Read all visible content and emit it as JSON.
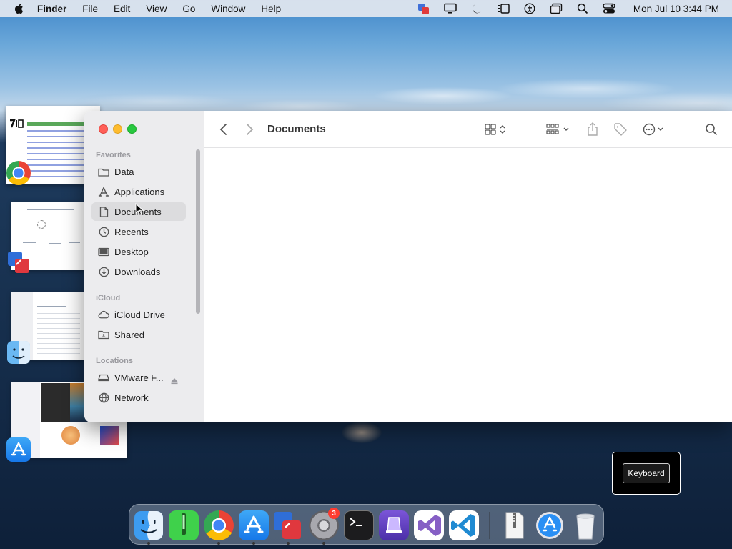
{
  "menubar": {
    "apple": "apple-logo-icon",
    "app_name": "Finder",
    "items": [
      "File",
      "Edit",
      "View",
      "Go",
      "Window",
      "Help"
    ],
    "status_icons": [
      "vmware-icon",
      "display-icon",
      "focus-moon-icon",
      "stage-manager-icon",
      "accessibility-icon",
      "window-icon",
      "spotlight-search-icon",
      "control-center-icon"
    ],
    "clock": "Mon Jul 10  3:44 PM"
  },
  "finder": {
    "title": "Documents",
    "sections": {
      "favorites": "Favorites",
      "icloud": "iCloud",
      "locations": "Locations"
    },
    "favorites": [
      "Data",
      "Applications",
      "Documents",
      "Recents",
      "Desktop",
      "Downloads"
    ],
    "icloud_items": [
      "iCloud Drive",
      "Shared"
    ],
    "location_items": [
      "VMware F...",
      "Network"
    ],
    "selected_item": "Documents"
  },
  "keyboard": {
    "label": "Keyboard"
  },
  "dock": {
    "apps": [
      "Finder",
      "Terminal Tool",
      "Google Chrome",
      "App Store",
      "VMware",
      "System Settings",
      "Terminal",
      "Apple Configurator",
      "Visual Studio",
      "Visual Studio Code",
      "Archive",
      "App Store Downloads",
      "Trash"
    ],
    "settings_badge": "3"
  },
  "colors": {
    "accent": "#2f7cf6",
    "close": "#ff5f57",
    "minimize": "#febc2e",
    "zoom": "#28c840"
  }
}
